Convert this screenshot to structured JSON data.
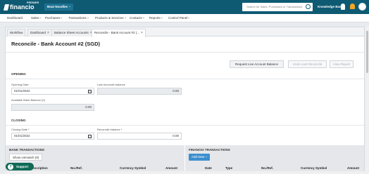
{
  "app": {
    "logo_text": "financio",
    "edition": "PREMIER",
    "org": "Boat Noodles"
  },
  "search": {
    "placeholder": "Search for Sales, Purchases or Transactions"
  },
  "topbar": {
    "knowledge_base": "Knowledge Base"
  },
  "nav": [
    {
      "label": "Dashboard",
      "dropdown": false
    },
    {
      "label": "Sales",
      "dropdown": true
    },
    {
      "label": "Purchases",
      "dropdown": true
    },
    {
      "label": "Transactions",
      "dropdown": true
    },
    {
      "label": "Products & Services",
      "dropdown": true
    },
    {
      "label": "Contacts",
      "dropdown": true
    },
    {
      "label": "Reports",
      "dropdown": true
    },
    {
      "label": "Control Panel",
      "dropdown": true
    }
  ],
  "tabs": [
    {
      "label": "Workflow",
      "closable": false,
      "active": false
    },
    {
      "label": "Dashboard",
      "closable": true,
      "active": false
    },
    {
      "label": "Balance Sheet Accounts",
      "closable": true,
      "active": false
    },
    {
      "label": "Reconcile - Bank Account #2 (...",
      "closable": true,
      "active": true
    }
  ],
  "page": {
    "title": "Reconcile - Bank Account #2 (SGD)"
  },
  "actions": {
    "request_live": "Request Live Account Balance",
    "undo_last": "Undo Last Reconcile",
    "view_report": "View Report"
  },
  "opening": {
    "section": "OPENING",
    "date_label": "Opening Date",
    "date_value": "01/01/2022",
    "last_label": "Last reconcile balance",
    "last_value": "0.00",
    "available_label": "Available Bank Balance (0)",
    "available_value": "0.00"
  },
  "closing": {
    "section": "CLOSING",
    "date_label": "Closing Date *",
    "date_value": "01/01/2022",
    "balance_label": "Reconcile balance *",
    "balance_value": "0.00"
  },
  "bank": {
    "title": "BANK TRANSACTIONS",
    "unmatch_button": "Show Unmatch (0)",
    "columns": [
      "Description",
      "No./Ref.",
      "Currency Symbol",
      "Amount"
    ]
  },
  "financio": {
    "title": "FINANCIO TRANSACTIONS",
    "add_button": "Add New",
    "columns": [
      "Date",
      "Type",
      "No./Ref.",
      "Currency Symbol",
      "Amount"
    ]
  },
  "support": {
    "label": "Support"
  },
  "colors": {
    "topbar": "#0f5a73",
    "primary_button": "#3c8fcf",
    "support": "#0f6b57"
  }
}
